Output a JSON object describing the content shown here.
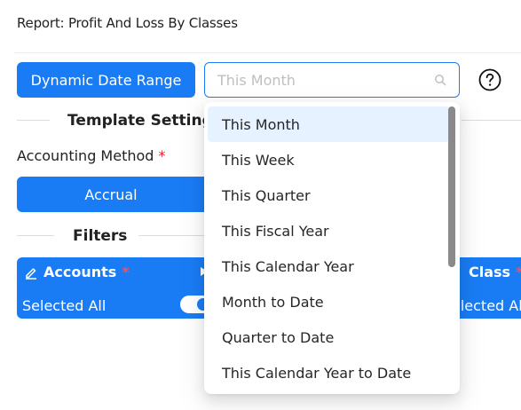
{
  "report": {
    "title": "Report: Profit And Loss By Classes"
  },
  "date_range": {
    "button_label": "Dynamic Date Range",
    "placeholder": "This Month",
    "options": [
      "This Month",
      "This Week",
      "This Quarter",
      "This Fiscal Year",
      "This Calendar Year",
      "Month to Date",
      "Quarter to Date",
      "This Calendar Year to Date"
    ],
    "highlighted_option": "This Month"
  },
  "template_settings": {
    "heading": "Template Setting",
    "accounting_method_label": "Accounting Method",
    "required_mark": "*",
    "accrual_label": "Accrual"
  },
  "filters": {
    "heading": "Filters",
    "accounts": {
      "title": "Accounts",
      "required_mark": "*",
      "status": "Selected All",
      "toggle_on": true
    },
    "class": {
      "title": "Class",
      "required_mark": "*",
      "status": "elected All"
    }
  },
  "colors": {
    "primary": "#1a7cf5",
    "required": "#e5202e",
    "highlight": "#e6f2ff"
  },
  "icons": [
    "search-icon",
    "help-icon",
    "edit-icon",
    "arrow-right-icon"
  ]
}
